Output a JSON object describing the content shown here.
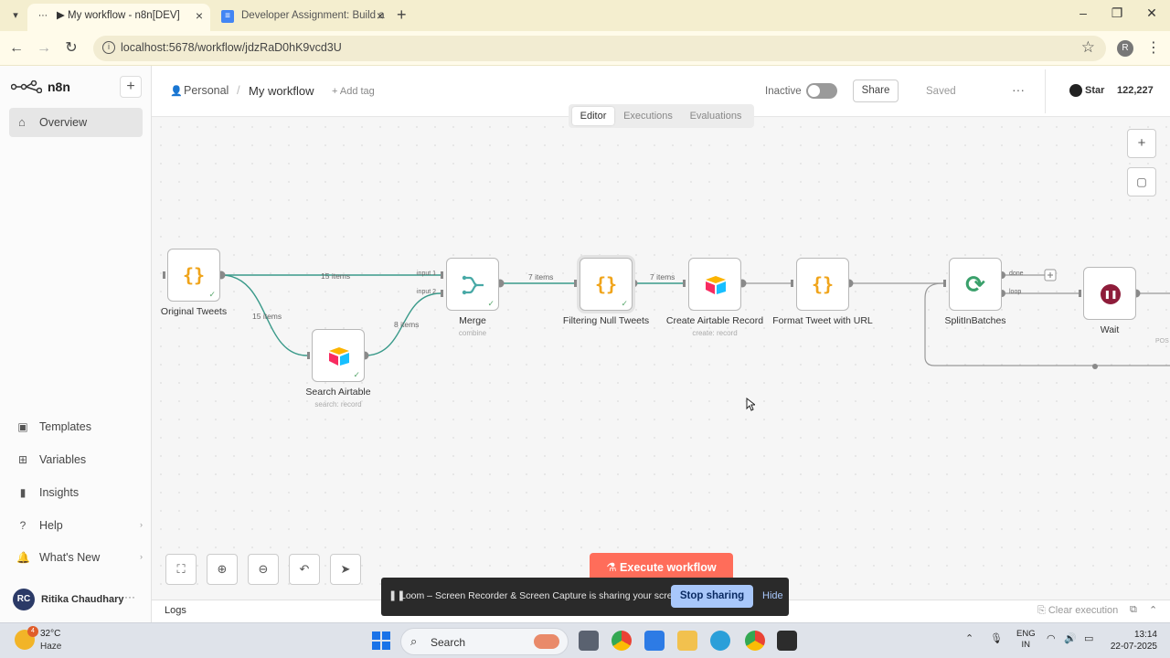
{
  "browser": {
    "tabs": [
      {
        "title": "▶ My workflow - n8n[DEV]",
        "active": true
      },
      {
        "title": "Developer Assignment: Build a",
        "active": false
      }
    ],
    "url": "localhost:5678/workflow/jdzRaD0hK9vcd3U",
    "profile_initial": "R"
  },
  "sidebar": {
    "logo": "n8n",
    "overview": "Overview",
    "items": [
      {
        "label": "Templates",
        "icon": "templates-icon"
      },
      {
        "label": "Variables",
        "icon": "variables-icon"
      },
      {
        "label": "Insights",
        "icon": "insights-icon"
      },
      {
        "label": "Help",
        "icon": "help-icon"
      },
      {
        "label": "What's New",
        "icon": "whats-new-icon"
      }
    ],
    "user": {
      "initials": "RC",
      "name": "Ritika Chaudhary"
    }
  },
  "header": {
    "project": "Personal",
    "workflow_name": "My workflow",
    "add_tag": "+ Add tag",
    "status": "Inactive",
    "share": "Share",
    "saved": "Saved",
    "github_star": "Star",
    "github_count": "122,227"
  },
  "view_tabs": [
    "Editor",
    "Executions",
    "Evaluations"
  ],
  "workflow": {
    "nodes": [
      {
        "name": "Original Tweets",
        "subtitle": ""
      },
      {
        "name": "Search Airtable",
        "subtitle": "search: record"
      },
      {
        "name": "Merge",
        "subtitle": "combine"
      },
      {
        "name": "Filtering Null Tweets",
        "subtitle": ""
      },
      {
        "name": "Create Airtable Record",
        "subtitle": "create: record"
      },
      {
        "name": "Format Tweet with URL",
        "subtitle": ""
      },
      {
        "name": "SplitInBatches",
        "subtitle": ""
      },
      {
        "name": "Wait",
        "subtitle": ""
      }
    ],
    "edge_labels": {
      "orig_merge": "15 items",
      "orig_search": "15 items",
      "search_merge": "8 items",
      "merge_filter": "7 items",
      "filter_create": "7 items",
      "input1": "input 1",
      "input2": "input 2",
      "done": "done",
      "loop": "loop",
      "pos": "POS"
    }
  },
  "execute_button": "Execute workflow",
  "logs": {
    "label": "Logs",
    "clear": "Clear execution"
  },
  "loom": {
    "message": "Loom – Screen Recorder & Screen Capture is sharing your screen.",
    "stop": "Stop sharing",
    "hide": "Hide"
  },
  "taskbar": {
    "weather_temp": "32°C",
    "weather_desc": "Haze",
    "weather_badge": "4",
    "search": "Search",
    "lang_1": "ENG",
    "lang_2": "IN",
    "time": "13:14",
    "date": "22-07-2025"
  },
  "colors": {
    "accent": "#ff6d5a",
    "edge": "#3a9a8a",
    "wait": "#8e1c3a"
  }
}
